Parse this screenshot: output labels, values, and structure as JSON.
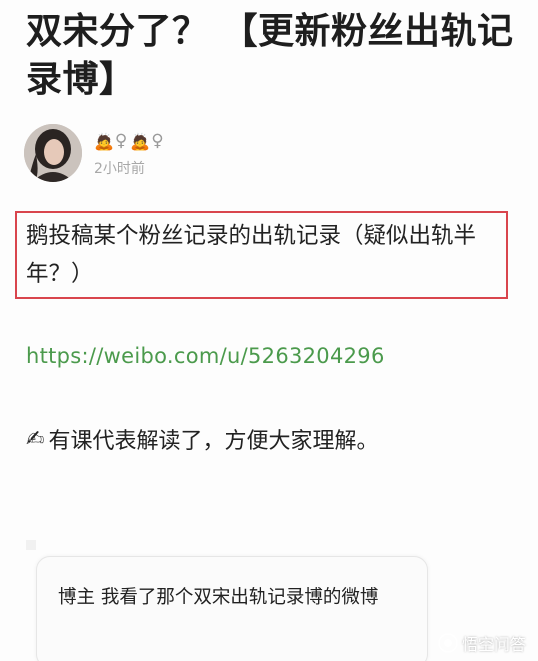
{
  "post": {
    "title": "双宋分了？ 【更新粉丝出轨记录博】",
    "author": {
      "emoji_1": "🙇",
      "symbol_1": "♀",
      "emoji_2": "🙇",
      "symbol_2": "♀",
      "timestamp": "2小时前"
    },
    "highlighted_text": "鹅投稿某个粉丝记录的出轨记录（疑似出轨半年？）",
    "link": "https://weibo.com/u/5263204296",
    "explain_emoji": "✍",
    "explain_text": "有课代表解读了，方便大家理解。",
    "quote": "博主 我看了那个双宋出轨记录博的微博"
  },
  "watermark": {
    "text": "悟空问答"
  },
  "colors": {
    "highlight_border": "#d9454d",
    "link": "#4b9a4c",
    "title": "#1e1e1e"
  }
}
